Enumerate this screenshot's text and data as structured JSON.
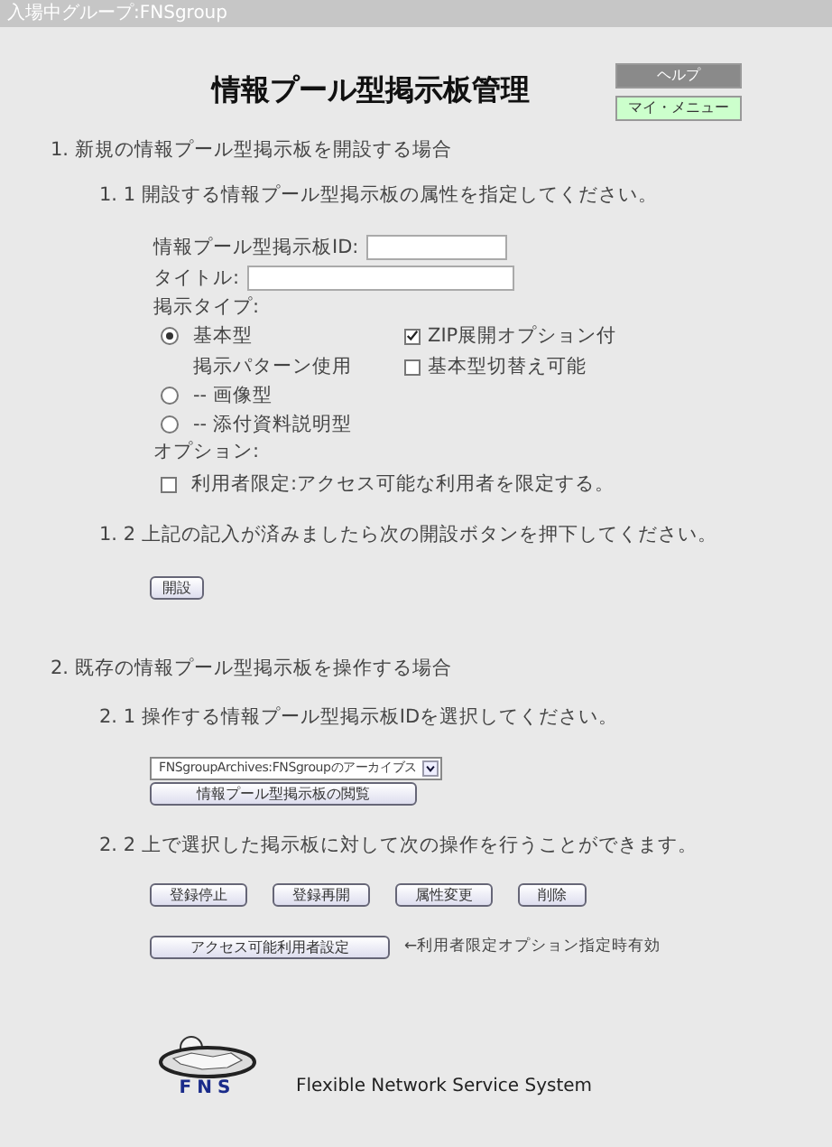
{
  "header": {
    "group_label": "入場中グループ:FNSgroup"
  },
  "title": "情報プール型掲示板管理",
  "side_buttons": [
    {
      "label": "ヘルプ",
      "kind": "help"
    },
    {
      "label": "マイ・メニュー",
      "kind": "menu"
    }
  ],
  "section_create": {
    "heading": "1. 新規の情報プール型掲示板を開設する場合",
    "step_1": "1. 1 開設する情報プール型掲示板の属性を指定してください。",
    "fields": [
      {
        "label": "情報プール型掲示板ID:",
        "kind": "short"
      },
      {
        "label": "タイトル:",
        "kind": "long"
      }
    ],
    "type_label": "掲示タイプ:",
    "types": [
      {
        "label": "基本型",
        "selected": true,
        "sublabel": "掲示パターン使用",
        "options": [
          {
            "label": "ZIP展開オプション付",
            "checked": true
          },
          {
            "label": "基本型切替え可能",
            "checked": false
          }
        ]
      },
      {
        "label": "-- 画像型",
        "selected": false
      },
      {
        "label": "-- 添付資料説明型",
        "selected": false
      }
    ],
    "option_label": "オプション:",
    "options": [
      {
        "label": "利用者限定:アクセス可能な利用者を限定する。",
        "checked": false
      }
    ],
    "step_2": "1. 2 上記の記入が済みましたら次の開設ボタンを押下してください。",
    "open_button": "開設"
  },
  "section_manage": {
    "heading": "2. 既存の情報プール型掲示板を操作する場合",
    "step_1": "2. 1 操作する情報プール型掲示板IDを選択してください。",
    "board_select": "FNSgroupArchives:FNSgroupのアーカイブス",
    "browse_button": "情報プール型掲示板の閲覧",
    "step_2": "2. 2 上で選択した掲示板に対して次の操作を行うことができます。",
    "actions": [
      "登録停止",
      "登録再開",
      "属性変更",
      "削除"
    ],
    "access_button": "アクセス可能利用者設定",
    "access_note": "←利用者限定オプション指定時有効"
  },
  "footer": {
    "logo_text": "FNS",
    "system_name": "Flexible Network Service System"
  }
}
